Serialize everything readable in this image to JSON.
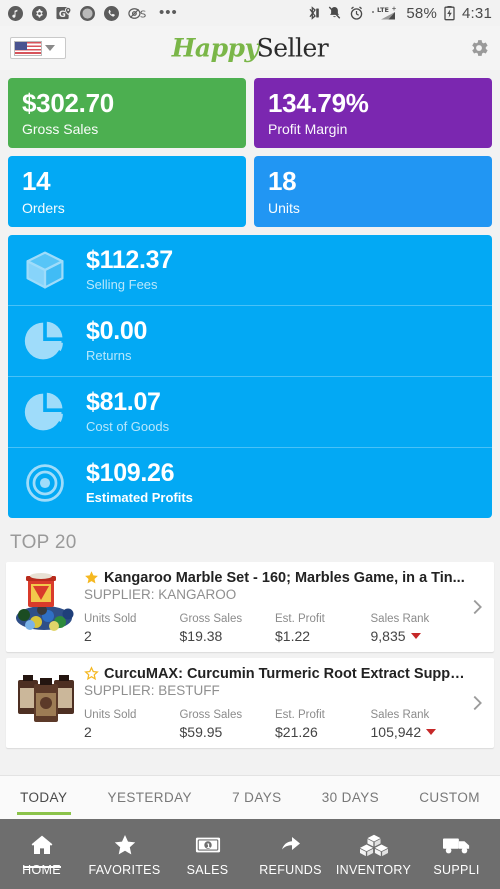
{
  "statusbar": {
    "left_icons": [
      "music-note-icon",
      "puzzle-icon",
      "maps-pin-icon",
      "circle-icon",
      "phone-icon",
      "at-s-icon"
    ],
    "overflow": "•••",
    "right_icons": [
      "bluetooth-icon",
      "bell-muted-icon",
      "alarm-clock-icon",
      "lte-signal-icon",
      "battery-charging-icon"
    ],
    "network": "LTE+",
    "battery": "58%",
    "time": "4:31"
  },
  "header": {
    "country": "US",
    "logo_first": "Happy",
    "logo_second": "Seller",
    "settings_icon": "gear-icon"
  },
  "kpis": [
    {
      "value": "$302.70",
      "label": "Gross Sales",
      "color": "#4caf50"
    },
    {
      "value": "134.79%",
      "label": "Profit Margin",
      "color": "#7b27b0"
    },
    {
      "value": "14",
      "label": "Orders",
      "color": "#03a9f4"
    },
    {
      "value": "18",
      "label": "Units",
      "color": "#2196f3"
    }
  ],
  "metrics": [
    {
      "value": "$112.37",
      "label": "Selling Fees",
      "icon": "box-icon",
      "emphasis": false
    },
    {
      "value": "$0.00",
      "label": "Returns",
      "icon": "pie-chart-icon",
      "emphasis": false
    },
    {
      "value": "$81.07",
      "label": "Cost of Goods",
      "icon": "pie-chart-icon",
      "emphasis": false
    },
    {
      "value": "$109.26",
      "label": "Estimated Profits",
      "icon": "target-icon",
      "emphasis": true
    }
  ],
  "top_section": {
    "title": "TOP 20",
    "columns": [
      "Units Sold",
      "Gross Sales",
      "Est. Profit",
      "Sales Rank"
    ],
    "products": [
      {
        "favorite": true,
        "star_icon": "star-filled-icon",
        "title": "Kangaroo Marble Set - 160; Marbles Game, in a Tin...",
        "supplier": "SUPPLIER: KANGAROO",
        "units_sold": "2",
        "gross_sales": "$19.38",
        "est_profit": "$1.22",
        "sales_rank": "9,835",
        "rank_trend": "down",
        "thumb": "marbles-tin-thumbnail"
      },
      {
        "favorite": false,
        "star_icon": "star-outline-icon",
        "title": "CurcuMAX: Curcumin Turmeric Root Extract Suppl...",
        "supplier": "SUPPLIER: BESTUFF",
        "units_sold": "2",
        "gross_sales": "$59.95",
        "est_profit": "$21.26",
        "sales_rank": "105,942",
        "rank_trend": "down",
        "thumb": "supplement-bottles-thumbnail"
      }
    ]
  },
  "period_tabs": [
    {
      "label": "TODAY",
      "active": true
    },
    {
      "label": "YESTERDAY",
      "active": false
    },
    {
      "label": "7 DAYS",
      "active": false
    },
    {
      "label": "30 DAYS",
      "active": false
    },
    {
      "label": "CUSTOM",
      "active": false
    }
  ],
  "bottom_nav": [
    {
      "label": "HOME",
      "icon": "home-icon",
      "active": true
    },
    {
      "label": "FAVORITES",
      "icon": "star-icon",
      "active": false
    },
    {
      "label": "SALES",
      "icon": "banknote-icon",
      "active": false
    },
    {
      "label": "REFUNDS",
      "icon": "arrow-return-icon",
      "active": false
    },
    {
      "label": "INVENTORY",
      "icon": "boxes-icon",
      "active": false
    },
    {
      "label": "SUPPLI",
      "icon": "truck-icon",
      "active": false
    }
  ],
  "colors": {
    "accent_green": "#8bc34a",
    "brand_blue": "#03a9f4",
    "nav_bg": "#6e6e6e"
  }
}
